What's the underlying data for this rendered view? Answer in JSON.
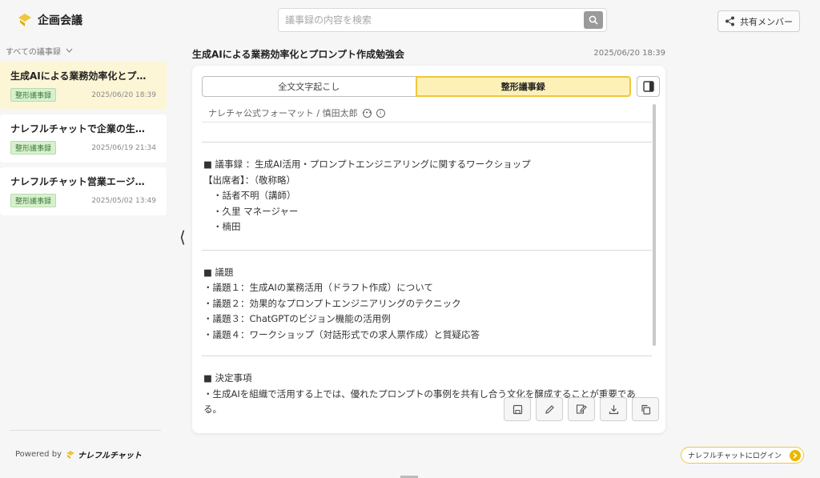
{
  "app": {
    "title": "企画会議"
  },
  "search": {
    "placeholder": "議事録の内容を検索"
  },
  "header": {
    "share_label": "共有メンバー"
  },
  "sidebar": {
    "filter_label": "すべての議事録",
    "records": [
      {
        "title": "生成AIによる業務効率化とプ…",
        "badge": "整形議事録",
        "date": "2025/06/20 18:39",
        "active": true
      },
      {
        "title": "ナレフルチャットで企業の生…",
        "badge": "整形議事録",
        "date": "2025/06/19 21:34",
        "active": false
      },
      {
        "title": "ナレフルチャット営業エージ…",
        "badge": "整形議事録",
        "date": "2025/05/02 13:49",
        "active": false
      }
    ],
    "powered_by": "Powered by",
    "brand": "ナレフルチャット"
  },
  "meeting": {
    "title": "生成AIによる業務効率化とプロンプト作成勉強会",
    "date": "2025/06/20 18:39",
    "tabs": {
      "transcript": "全文文字起こし",
      "formatted": "整形議事録"
    },
    "format_line": "ナレチャ公式フォーマット / 慎田太郎",
    "sec1": {
      "heading": "■ 議事録 ：生成AI活用・プロンプトエンジニアリングに関するワークショップ",
      "attendees_label": "【出席者】：（敬称略）",
      "a1": "・話者不明（講師）",
      "a2": "・久里 マネージャー",
      "a3": "・楠田"
    },
    "sec2": {
      "heading": "■ 議題",
      "i1": "・議題１：生成AIの業務活用（ドラフト作成）について",
      "i2": "・議題２：効果的なプロンプトエンジニアリングのテクニック",
      "i3": "・議題３：ChatGPTのビジョン機能の活用例",
      "i4": "・議題４：ワークショップ（対話形式での求人票作成）と質疑応答"
    },
    "sec3": {
      "heading": "■ 決定事項",
      "d1": "・生成AIを組織で活用する上では、優れたプロンプトの事例を共有し合う文化を醸成することが重要である。"
    }
  },
  "footer": {
    "login_label": "ナレフルチャットにログイン"
  },
  "colors": {
    "accent": "#f0c73b",
    "active_bg": "#fdf6d6",
    "badge_bg": "#d8f0d0",
    "badge_text": "#3b7a34"
  },
  "icons": [
    "logo-icon",
    "search-icon",
    "share-icon",
    "chevron-down-icon",
    "collapse-arrow-icon",
    "layout-toggle-icon",
    "more-icon",
    "info-icon",
    "save-icon",
    "edit-icon",
    "edit-note-icon",
    "download-icon",
    "copy-icon",
    "arrow-right-icon"
  ]
}
